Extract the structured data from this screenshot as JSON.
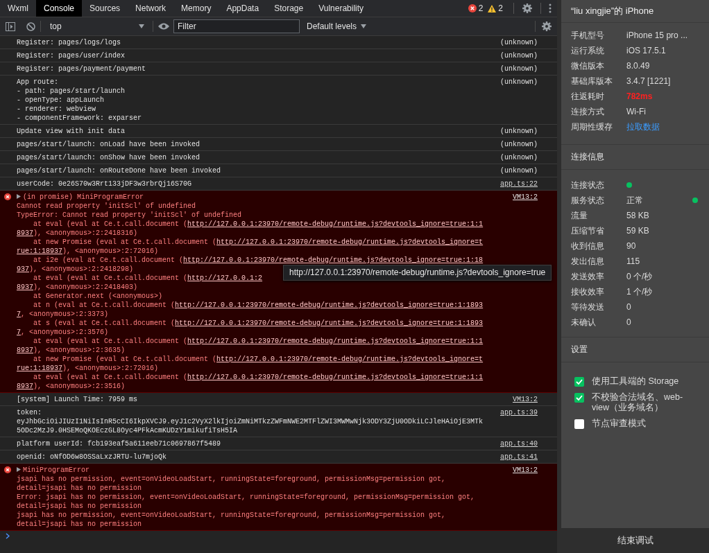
{
  "tabs": [
    {
      "label": "Wxml",
      "selected": false
    },
    {
      "label": "Console",
      "selected": true
    },
    {
      "label": "Sources",
      "selected": false
    },
    {
      "label": "Network",
      "selected": false
    },
    {
      "label": "Memory",
      "selected": false
    },
    {
      "label": "AppData",
      "selected": false
    },
    {
      "label": "Storage",
      "selected": false
    },
    {
      "label": "Vulnerability",
      "selected": false
    }
  ],
  "counts": {
    "errors": "2",
    "warnings": "2"
  },
  "toolbar": {
    "context": "top",
    "filter": {
      "placeholder": "Filter"
    },
    "levels": "Default levels"
  },
  "messages": [
    {
      "kind": "log",
      "source": {
        "text": "(unknown)",
        "link": false
      },
      "lines": [
        [
          {
            "kind": "text",
            "text": "Register: pages/logs/logs"
          }
        ]
      ]
    },
    {
      "kind": "log",
      "source": {
        "text": "(unknown)",
        "link": false
      },
      "lines": [
        [
          {
            "kind": "text",
            "text": "Register: pages/user/index"
          }
        ]
      ]
    },
    {
      "kind": "log",
      "source": {
        "text": "(unknown)",
        "link": false
      },
      "lines": [
        [
          {
            "kind": "text",
            "text": "Register: pages/payment/payment"
          }
        ]
      ]
    },
    {
      "kind": "log",
      "source": {
        "text": "(unknown)",
        "link": false
      },
      "lines": [
        [
          {
            "kind": "text",
            "text": "App route:"
          }
        ],
        [
          {
            "kind": "text",
            "text": "- path: pages/start/launch"
          }
        ],
        [
          {
            "kind": "text",
            "text": "- openType: appLaunch"
          }
        ],
        [
          {
            "kind": "text",
            "text": "- renderer: webview"
          }
        ],
        [
          {
            "kind": "text",
            "text": "- componentFramework: exparser"
          }
        ]
      ]
    },
    {
      "kind": "log",
      "source": {
        "text": "(unknown)",
        "link": false
      },
      "lines": [
        [
          {
            "kind": "text",
            "text": "Update view with init data"
          }
        ]
      ]
    },
    {
      "kind": "log",
      "source": {
        "text": "(unknown)",
        "link": false
      },
      "lines": [
        [
          {
            "kind": "text",
            "text": "pages/start/launch: onLoad have been invoked"
          }
        ]
      ]
    },
    {
      "kind": "log",
      "source": {
        "text": "(unknown)",
        "link": false
      },
      "lines": [
        [
          {
            "kind": "text",
            "text": "pages/start/launch: onShow have been invoked"
          }
        ]
      ]
    },
    {
      "kind": "log",
      "source": {
        "text": "(unknown)",
        "link": false
      },
      "lines": [
        [
          {
            "kind": "text",
            "text": "pages/start/launch: onRouteDone have been invoked"
          }
        ]
      ]
    },
    {
      "kind": "log",
      "source": {
        "text": "app.ts:22",
        "link": true
      },
      "lines": [
        [
          {
            "kind": "text",
            "text": "userCode: 0e26S70w3Rrt133jDF3w3rbrQj16S70G"
          }
        ]
      ]
    },
    {
      "kind": "error",
      "source": {
        "text": "VM13:2",
        "link": true
      },
      "lines": [
        [
          {
            "kind": "text",
            "text": "(in promise) MiniProgramError"
          }
        ],
        [
          {
            "kind": "text",
            "text": "Cannot read property 'initScl' of undefined"
          }
        ],
        [
          {
            "kind": "text",
            "text": "TypeError: Cannot read property 'initScl' of undefined"
          }
        ],
        [
          {
            "kind": "text",
            "text": "    at eval (eval at Ce.t.call.document ("
          },
          {
            "kind": "link",
            "text": "http://127.0.0.1:23970/remote-debug/runtime.js?devtools_ignore=true:1:1"
          }
        ],
        [
          {
            "kind": "link",
            "text": "8937"
          },
          {
            "kind": "text",
            "text": "), <anonymous>:2:2418316)"
          }
        ],
        [
          {
            "kind": "text",
            "text": "    at new Promise (eval at Ce.t.call.document ("
          },
          {
            "kind": "link",
            "text": "http://127.0.0.1:23970/remote-debug/runtime.js?devtools_ignore=t"
          }
        ],
        [
          {
            "kind": "link",
            "text": "rue:1:18937"
          },
          {
            "kind": "text",
            "text": "), <anonymous>:2:72016)"
          }
        ],
        [
          {
            "kind": "text",
            "text": "    at i2e (eval at Ce.t.call.document ("
          },
          {
            "kind": "link",
            "text": "http://127.0.0.1:23970/remote-debug/runtime.js?devtools_ignore=true:1:18"
          }
        ],
        [
          {
            "kind": "link",
            "text": "937"
          },
          {
            "kind": "text",
            "text": "), <anonymous>:2:2418298)"
          }
        ],
        [
          {
            "kind": "text",
            "text": "    at eval (eval at Ce.t.call.document ("
          },
          {
            "kind": "link",
            "text": "http://127.0.0.1:2"
          }
        ],
        [
          {
            "kind": "link",
            "text": "8937"
          },
          {
            "kind": "text",
            "text": "), <anonymous>:2:2418403)"
          }
        ],
        [
          {
            "kind": "text",
            "text": "    at Generator.next (<anonymous>)"
          }
        ],
        [
          {
            "kind": "text",
            "text": "    at n (eval at Ce.t.call.document ("
          },
          {
            "kind": "link",
            "text": "http://127.0.0.1:23970/remote-debug/runtime.js?devtools_ignore=true:1:1893"
          }
        ],
        [
          {
            "kind": "link",
            "text": "7"
          },
          {
            "kind": "text",
            "text": ", <anonymous>:2:3373)"
          }
        ],
        [
          {
            "kind": "text",
            "text": "    at s (eval at Ce.t.call.document ("
          },
          {
            "kind": "link",
            "text": "http://127.0.0.1:23970/remote-debug/runtime.js?devtools_ignore=true:1:1893"
          }
        ],
        [
          {
            "kind": "link",
            "text": "7"
          },
          {
            "kind": "text",
            "text": ", <anonymous>:2:3576)"
          }
        ],
        [
          {
            "kind": "text",
            "text": "    at eval (eval at Ce.t.call.document ("
          },
          {
            "kind": "link",
            "text": "http://127.0.0.1:23970/remote-debug/runtime.js?devtools_ignore=true:1:1"
          }
        ],
        [
          {
            "kind": "link",
            "text": "8937"
          },
          {
            "kind": "text",
            "text": "), <anonymous>:2:3635)"
          }
        ],
        [
          {
            "kind": "text",
            "text": "    at new Promise (eval at Ce.t.call.document ("
          },
          {
            "kind": "link",
            "text": "http://127.0.0.1:23970/remote-debug/runtime.js?devtools_ignore=t"
          }
        ],
        [
          {
            "kind": "link",
            "text": "rue:1:18937"
          },
          {
            "kind": "text",
            "text": "), <anonymous>:2:72016)"
          }
        ],
        [
          {
            "kind": "text",
            "text": "    at eval (eval at Ce.t.call.document ("
          },
          {
            "kind": "link",
            "text": "http://127.0.0.1:23970/remote-debug/runtime.js?devtools_ignore=true:1:1"
          }
        ],
        [
          {
            "kind": "link",
            "text": "8937"
          },
          {
            "kind": "text",
            "text": "), <anonymous>:2:3516)"
          }
        ]
      ]
    },
    {
      "kind": "log",
      "source": {
        "text": "VM13:2",
        "link": true
      },
      "lines": [
        [
          {
            "kind": "text",
            "text": "[system] Launch Time: 7959 ms"
          }
        ]
      ]
    },
    {
      "kind": "log",
      "source": {
        "text": "app.ts:39",
        "link": true
      },
      "lines": [
        [
          {
            "kind": "text",
            "text": "token:"
          }
        ],
        [
          {
            "kind": "text",
            "text": "eyJhbGciOiJIUzI1NiIsInR5cCI6IkpXVCJ9.eyJ1c2VyX2lkIjoiZmNiMTkzZWFmNWE2MTFlZWI3MWMwNjk3ODY3ZjU0ODkiLCJleHAiOjE3MTk"
          }
        ],
        [
          {
            "kind": "text",
            "text": "5ODc2MzJ9.0HSEMoQKOEczGL8Oyc4PFkAcmKUDzY1mikufiTsH5IA"
          }
        ]
      ]
    },
    {
      "kind": "log",
      "source": {
        "text": "app.ts:40",
        "link": true
      },
      "lines": [
        [
          {
            "kind": "text",
            "text": "platform userId: fcb193eaf5a611eeb71c0697867f5489"
          }
        ]
      ]
    },
    {
      "kind": "log",
      "source": {
        "text": "app.ts:41",
        "link": true
      },
      "lines": [
        [
          {
            "kind": "text",
            "text": "openid: oNfOD6w8OSSaLxzJRTU-lu7mjoQk"
          }
        ]
      ]
    },
    {
      "kind": "error",
      "source": {
        "text": "VM13:2",
        "link": true
      },
      "lines": [
        [
          {
            "kind": "text",
            "text": "MiniProgramError"
          }
        ],
        [
          {
            "kind": "text",
            "text": "jsapi has no permission, event=onVideoLoadStart, runningState=foreground, permissionMsg=permission got,"
          }
        ],
        [
          {
            "kind": "text",
            "text": "detail=jsapi has no permission"
          }
        ],
        [
          {
            "kind": "text",
            "text": "Error: jsapi has no permission, event=onVideoLoadStart, runningState=foreground, permissionMsg=permission got,"
          }
        ],
        [
          {
            "kind": "text",
            "text": "detail=jsapi has no permission"
          }
        ],
        [
          {
            "kind": "text",
            "text": "jsapi has no permission, event=onVideoLoadStart, runningState=foreground, permissionMsg=permission got,"
          }
        ],
        [
          {
            "kind": "text",
            "text": "detail=jsapi has no permission"
          }
        ]
      ]
    }
  ],
  "tooltip": {
    "text": "http://127.0.0.1:23970/remote-debug/runtime.js?devtools_ignore=true"
  },
  "sidebar": {
    "title": "“liu xingjie”的 iPhone",
    "device": [
      {
        "label": "手机型号",
        "kind": "text",
        "value": "iPhone 15 pro ..."
      },
      {
        "label": "运行系统",
        "kind": "text",
        "value": "iOS 17.5.1"
      },
      {
        "label": "微信版本",
        "kind": "text",
        "value": "8.0.49"
      },
      {
        "label": "基础库版本",
        "kind": "text",
        "value": "3.4.7 [1221]"
      },
      {
        "label": "往返耗时",
        "kind": "alert",
        "value": "782ms"
      },
      {
        "label": "连接方式",
        "kind": "text",
        "value": "Wi-Fi"
      },
      {
        "label": "周期性缓存",
        "kind": "link",
        "value": "拉取数据"
      }
    ],
    "connection_title": "连接信息",
    "connection": [
      {
        "label": "连接状态",
        "kind": "dot"
      },
      {
        "label": "服务状态",
        "kind": "text_dot",
        "value": "正常"
      },
      {
        "label": "流量",
        "kind": "text",
        "value": "58 KB"
      },
      {
        "label": "压缩节省",
        "kind": "text",
        "value": "59 KB"
      },
      {
        "label": "收到信息",
        "kind": "text",
        "value": "90"
      },
      {
        "label": "发出信息",
        "kind": "text",
        "value": "115"
      },
      {
        "label": "发送效率",
        "kind": "text",
        "value": "0 个/秒"
      },
      {
        "label": "接收效率",
        "kind": "text",
        "value": "1 个/秒"
      },
      {
        "label": "等待发送",
        "kind": "text",
        "value": "0"
      },
      {
        "label": "未确认",
        "kind": "text",
        "value": "0"
      }
    ],
    "settings_title": "设置",
    "settings": [
      {
        "label": "使用工具端的 Storage",
        "checked": true
      },
      {
        "label": "不校验合法域名、web-view（业务域名）",
        "checked": true
      },
      {
        "label": "节点审查模式",
        "checked": false
      }
    ],
    "end_button": "结束调试"
  }
}
